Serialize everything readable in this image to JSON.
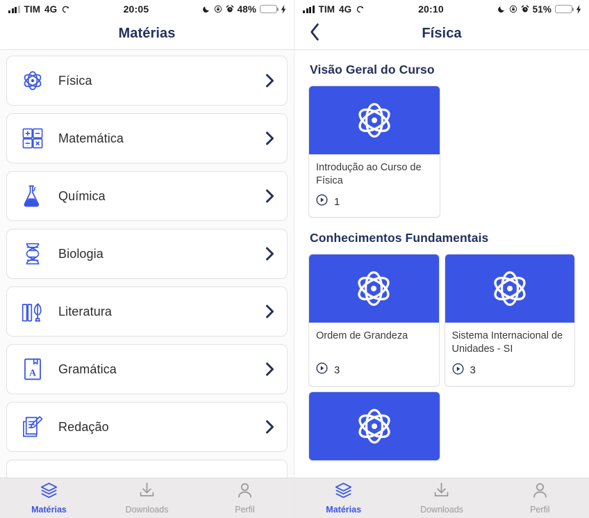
{
  "accent_blue": "#3a55e6",
  "navy": "#23305c",
  "battery_yellow": "#f7cf2e",
  "left": {
    "status": {
      "carrier": "TIM",
      "network": "4G",
      "location_icon": "location-arrow-icon",
      "time": "20:05",
      "moon_icon": "moon-icon",
      "rotation_lock_icon": "rotation-lock-icon",
      "alarm_icon": "alarm-clock-icon",
      "battery_percent": "48%",
      "battery_level": 48,
      "charging_icon": "lightning-bolt-icon"
    },
    "nav": {
      "title": "Matérias"
    },
    "subjects": [
      {
        "label": "Física",
        "icon": "atom-icon"
      },
      {
        "label": "Matemática",
        "icon": "calculator-icon"
      },
      {
        "label": "Química",
        "icon": "flask-icon"
      },
      {
        "label": "Biologia",
        "icon": "dna-icon"
      },
      {
        "label": "Literatura",
        "icon": "books-quill-icon"
      },
      {
        "label": "Gramática",
        "icon": "book-letter-a-icon"
      },
      {
        "label": "Redação",
        "icon": "document-pencil-icon"
      }
    ],
    "tabs": [
      {
        "label": "Matérias",
        "icon": "layers-icon",
        "active": true
      },
      {
        "label": "Downloads",
        "icon": "download-icon",
        "active": false
      },
      {
        "label": "Perfil",
        "icon": "person-icon",
        "active": false
      }
    ]
  },
  "right": {
    "status": {
      "carrier": "TIM",
      "network": "4G",
      "location_icon": "location-arrow-icon",
      "time": "20:10",
      "moon_icon": "moon-icon",
      "rotation_lock_icon": "rotation-lock-icon",
      "alarm_icon": "alarm-clock-icon",
      "battery_percent": "51%",
      "battery_level": 51,
      "charging_icon": "lightning-bolt-icon"
    },
    "nav": {
      "title": "Física",
      "back_icon": "chevron-left-icon"
    },
    "sections": [
      {
        "title": "Visão Geral do Curso",
        "cards": [
          {
            "name": "Introdução ao Curso de Física",
            "count": "1",
            "icon": "atom-icon"
          }
        ]
      },
      {
        "title": "Conhecimentos Fundamentais",
        "cards": [
          {
            "name": "Ordem de Grandeza",
            "count": "3",
            "icon": "atom-icon"
          },
          {
            "name": "Sistema Internacional de Unidades - SI",
            "count": "3",
            "icon": "atom-icon"
          },
          {
            "name": "",
            "count": "",
            "icon": "atom-icon"
          }
        ]
      }
    ],
    "tabs": [
      {
        "label": "Matérias",
        "icon": "layers-icon",
        "active": true
      },
      {
        "label": "Downloads",
        "icon": "download-icon",
        "active": false
      },
      {
        "label": "Perfil",
        "icon": "person-icon",
        "active": false
      }
    ]
  }
}
